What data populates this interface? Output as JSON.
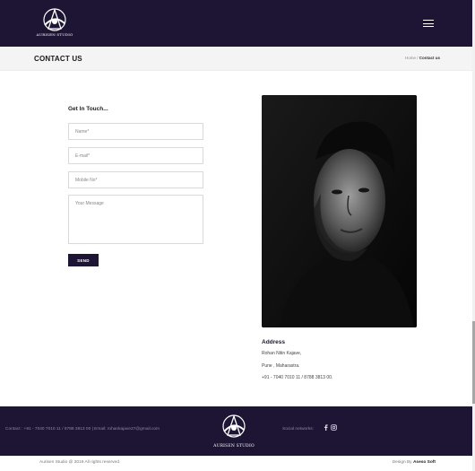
{
  "brand": {
    "logo_text": "AURISEN STUDIO"
  },
  "header": {
    "menu_icon": "hamburger-menu-icon"
  },
  "title_bar": {
    "title": "CONTACT US",
    "breadcrumb": {
      "home": "Home",
      "separator": " / ",
      "current": "Contact us"
    }
  },
  "form": {
    "heading": "Get In Touch...",
    "name_placeholder": "Name*",
    "email_placeholder": "E-mail*",
    "mobile_placeholder": "Mobile No*",
    "message_placeholder": "Your Message",
    "send_label": "SEND"
  },
  "address": {
    "title": "Address",
    "lines": [
      "Rohan Nitin Kajave,",
      "Pune , Maharastra.",
      "+91 - 7040 7010 11 / 8788 3813 00."
    ]
  },
  "footer": {
    "contact": "Contact : +91 - 7040 7010 11 / 8788 3813 00 | Email: rohankajave27@gmail.com",
    "social_label": "Social networks:",
    "social_icons": [
      "facebook-icon",
      "instagram-icon"
    ],
    "copyright": "Aurisen Studio @ 2019 All rights reserved.",
    "credit_prefix": "Design By",
    "credit_name": "Aseso Soft"
  },
  "colors": {
    "primary": "#1d1533",
    "footer_text": "#8e87a4"
  }
}
